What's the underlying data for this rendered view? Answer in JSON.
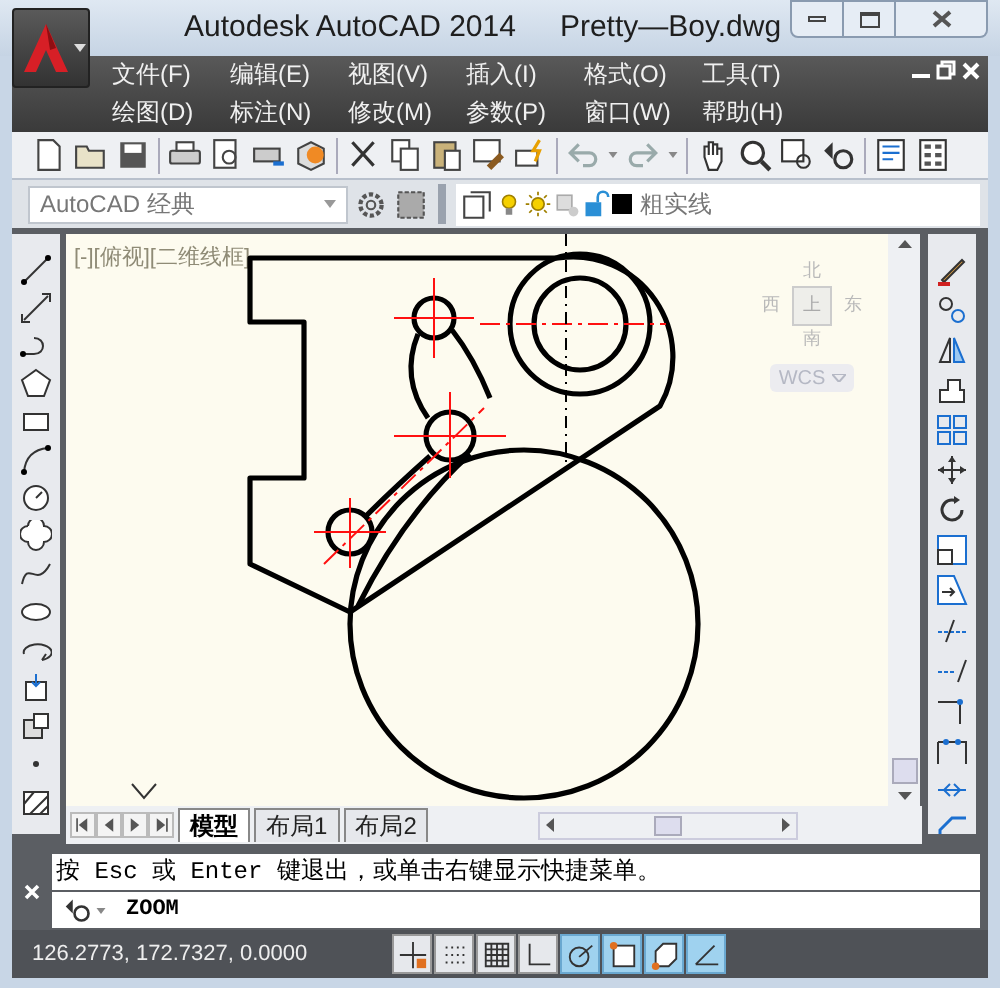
{
  "title_bar": {
    "app_title": "Autodesk AutoCAD 2014",
    "file_name": "Pretty—Boy.dwg"
  },
  "menu_bar": {
    "rows": [
      [
        "文件(F)",
        "编辑(E)",
        "视图(V)",
        "插入(I)",
        "格式(O)",
        "工具(T)"
      ],
      [
        "绘图(D)",
        "标注(N)",
        "修改(M)",
        "参数(P)",
        "窗口(W)",
        "帮助(H)"
      ]
    ]
  },
  "workspace": {
    "value": "AutoCAD 经典"
  },
  "layer": {
    "name": "粗实线"
  },
  "viewport": {
    "label": "[-][俯视][二维线框]"
  },
  "view_cube": {
    "north": "北",
    "west": "西",
    "east": "东",
    "south": "南",
    "face": "上",
    "ucs": "WCS"
  },
  "layout_tabs": [
    {
      "label": "模型",
      "selected": true
    },
    {
      "label": "布局1",
      "selected": false
    },
    {
      "label": "布局2",
      "selected": false
    }
  ],
  "command_line": {
    "history": "按 Esc 或 Enter 键退出，或单击右键显示快捷菜单。",
    "input": "ZOOM"
  },
  "status_bar": {
    "coordinates": "126.2773, 172.7327, 0.0000",
    "toggles": [
      {
        "kind": "infer",
        "on": false
      },
      {
        "kind": "snap",
        "on": false
      },
      {
        "kind": "grid",
        "on": false
      },
      {
        "kind": "ortho",
        "on": false
      },
      {
        "kind": "polar",
        "on": true
      },
      {
        "kind": "osnap",
        "on": true
      },
      {
        "kind": "osnap3d",
        "on": true
      },
      {
        "kind": "otrack",
        "on": true
      }
    ]
  }
}
